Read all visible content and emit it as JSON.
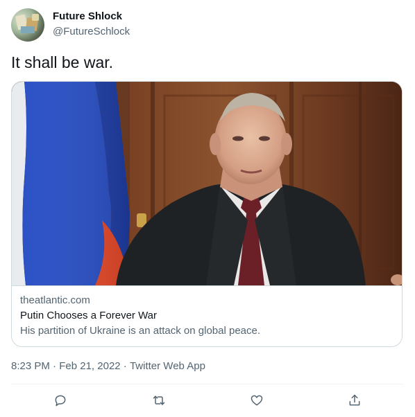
{
  "author": {
    "display_name": "Future Shlock",
    "handle": "@FutureSchlock",
    "avatar_icon": "avatar-collage-image"
  },
  "tweet": {
    "text": "It shall be war."
  },
  "card": {
    "image_icon": "article-photo-image",
    "domain": "theatlantic.com",
    "title": "Putin Chooses a Forever War",
    "description": "His partition of Ukraine is an attack on global peace."
  },
  "meta": {
    "time": "8:23 PM",
    "separator1": " · ",
    "date": "Feb 21, 2022",
    "separator2": " · ",
    "source": "Twitter Web App"
  },
  "actions": [
    {
      "name": "reply",
      "icon": "reply-icon"
    },
    {
      "name": "retweet",
      "icon": "retweet-icon"
    },
    {
      "name": "like",
      "icon": "heart-icon"
    },
    {
      "name": "share",
      "icon": "share-icon"
    }
  ],
  "colors": {
    "primary_text": "#0f1419",
    "secondary_text": "#536471",
    "border": "#cfd9de",
    "divider": "#eff3f4"
  }
}
